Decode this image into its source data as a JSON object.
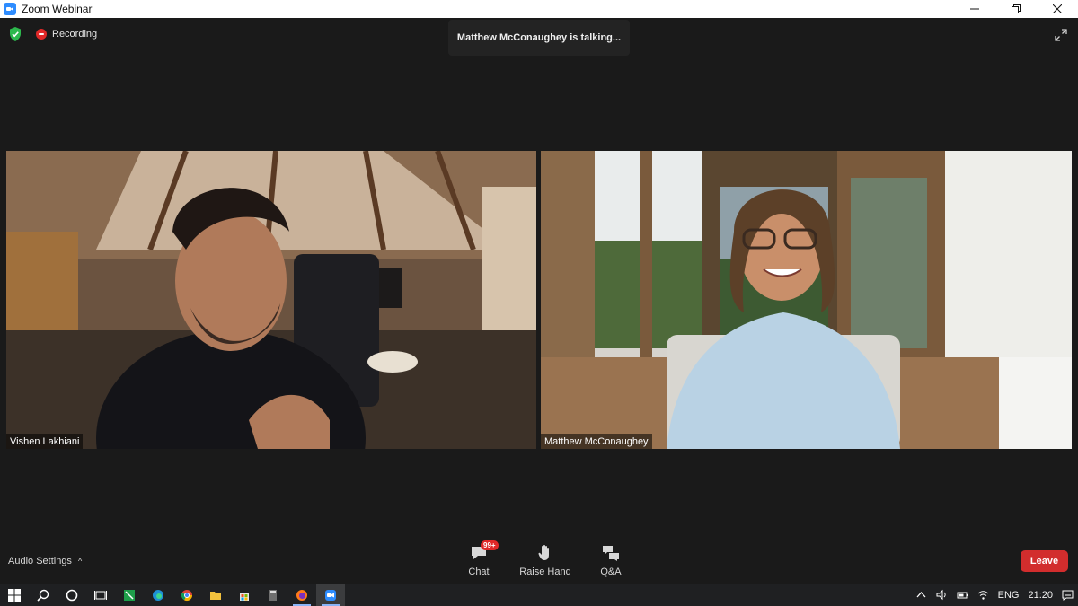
{
  "window": {
    "title": "Zoom Webinar"
  },
  "status": {
    "recording_label": "Recording",
    "talking_banner": "Matthew McConaughey is talking..."
  },
  "participants": [
    {
      "name": "Vishen Lakhiani"
    },
    {
      "name": "Matthew McConaughey"
    }
  ],
  "controls": {
    "audio_settings": "Audio Settings",
    "chat_label": "Chat",
    "chat_badge": "99+",
    "raise_hand_label": "Raise Hand",
    "qa_label": "Q&A",
    "leave_label": "Leave"
  },
  "taskbar": {
    "language": "ENG",
    "time": "21:20"
  },
  "colors": {
    "leave": "#d22d2d",
    "recording": "#e02828",
    "shield": "#2db84d",
    "zoom_blue": "#2d8cff"
  }
}
